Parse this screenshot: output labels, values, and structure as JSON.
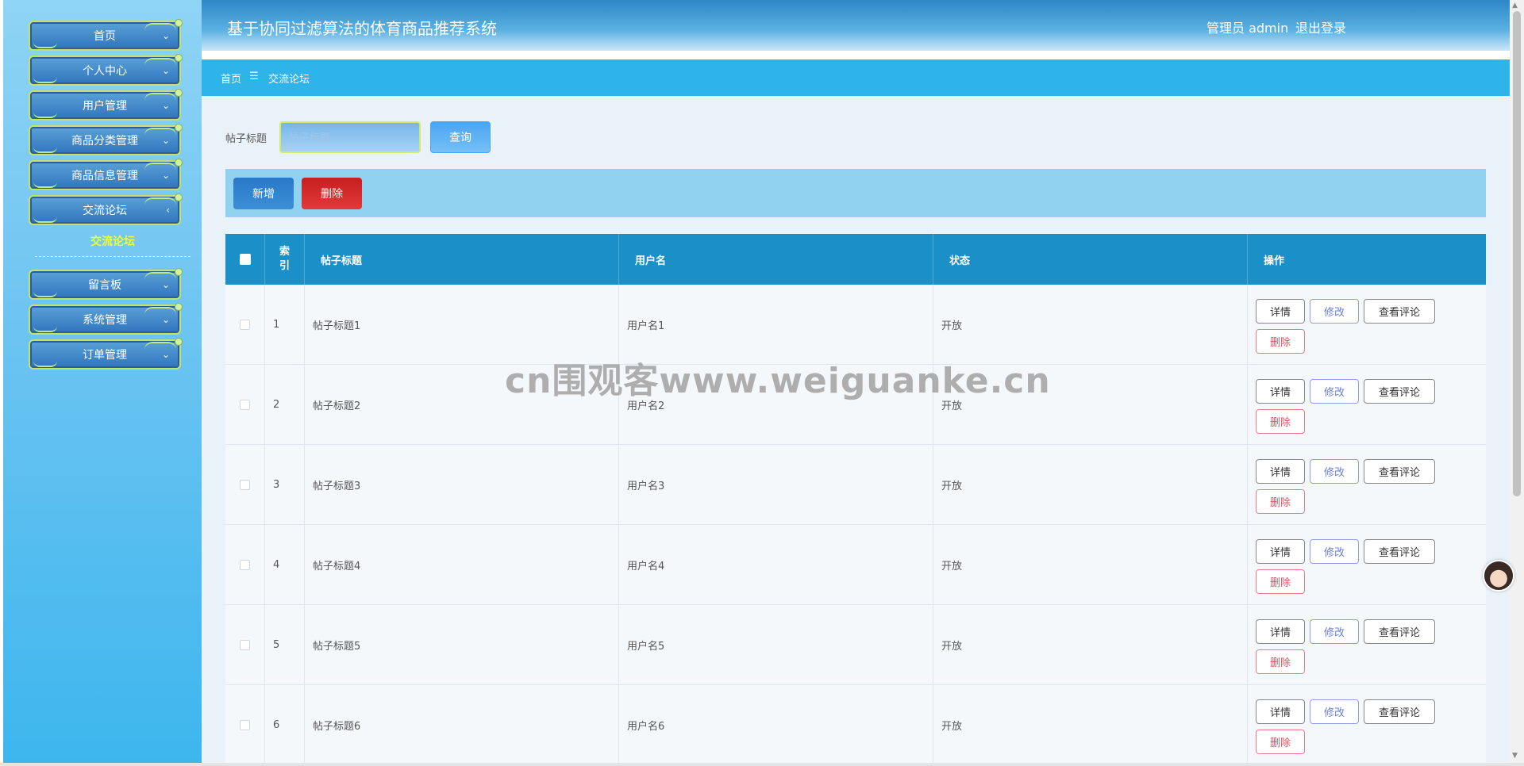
{
  "app": {
    "title": "基于协同过滤算法的体育商品推荐系统",
    "user_label": "管理员 admin",
    "logout_label": "退出登录"
  },
  "sidebar": {
    "items": [
      {
        "label": "首页"
      },
      {
        "label": "个人中心"
      },
      {
        "label": "用户管理"
      },
      {
        "label": "商品分类管理"
      },
      {
        "label": "商品信息管理"
      },
      {
        "label": "交流论坛"
      },
      {
        "label": "留言板"
      },
      {
        "label": "系统管理"
      },
      {
        "label": "订单管理"
      }
    ],
    "active_submenu": "交流论坛"
  },
  "breadcrumb": {
    "home": "首页",
    "separator": "☰",
    "current": "交流论坛"
  },
  "search": {
    "label": "帖子标题",
    "placeholder": "帖子标题",
    "value": "",
    "button_label": "查询"
  },
  "actions": {
    "add_label": "新增",
    "delete_label": "删除"
  },
  "table": {
    "columns": [
      "索引",
      "帖子标题",
      "用户名",
      "状态",
      "操作"
    ],
    "rows": [
      {
        "index": "1",
        "title": "帖子标题1",
        "user": "用户名1",
        "status": "开放"
      },
      {
        "index": "2",
        "title": "帖子标题2",
        "user": "用户名2",
        "status": "开放"
      },
      {
        "index": "3",
        "title": "帖子标题3",
        "user": "用户名3",
        "status": "开放"
      },
      {
        "index": "4",
        "title": "帖子标题4",
        "user": "用户名4",
        "status": "开放"
      },
      {
        "index": "5",
        "title": "帖子标题5",
        "user": "用户名5",
        "status": "开放"
      },
      {
        "index": "6",
        "title": "帖子标题6",
        "user": "用户名6",
        "status": "开放"
      }
    ],
    "row_actions": {
      "detail": "详情",
      "edit": "修改",
      "comments": "查看评论",
      "delete": "删除"
    }
  },
  "watermark": "cn围观客www.weiguanke.cn",
  "colors": {
    "header_blue": "#2d87c6",
    "breadcrumb_blue": "#2fb4ea",
    "table_header": "#1b8fc7",
    "delete_red": "#c71f1f",
    "submenu_yellow": "#f1ff2a"
  }
}
